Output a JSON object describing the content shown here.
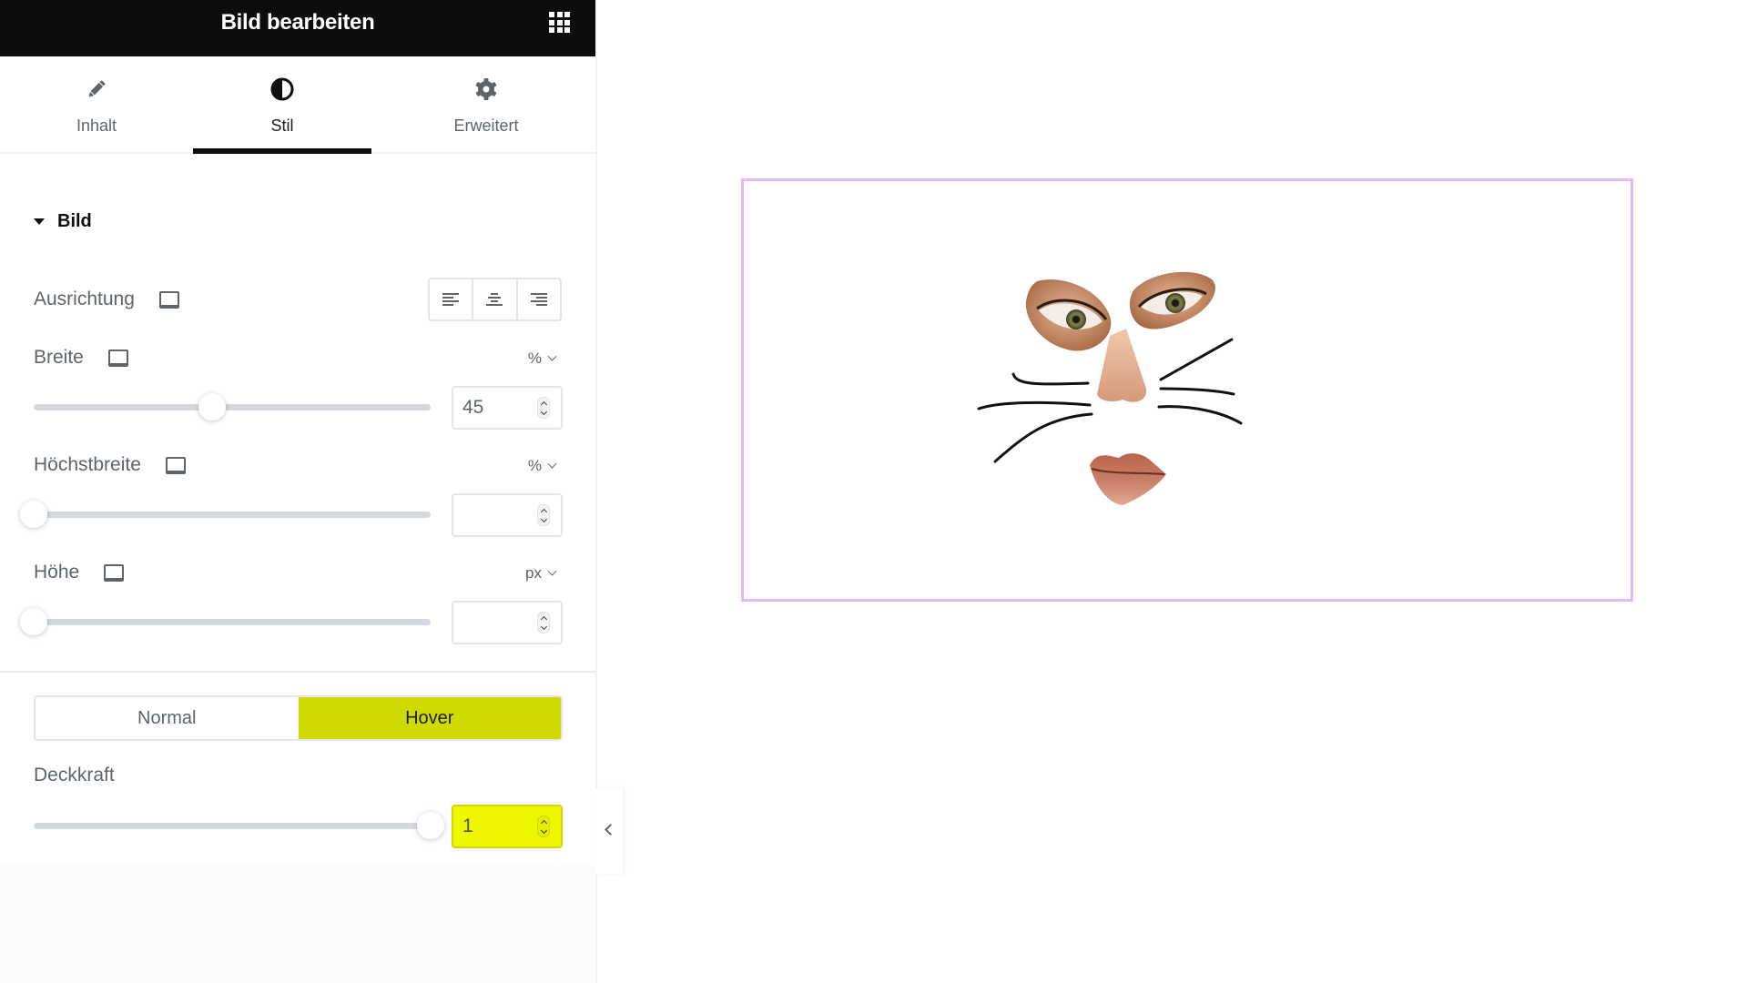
{
  "header": {
    "title": "Bild bearbeiten",
    "apps_icon": "grid-icon"
  },
  "tabs": [
    {
      "label": "Inhalt",
      "icon": "pencil-icon",
      "active": false
    },
    {
      "label": "Stil",
      "icon": "contrast-icon",
      "active": true
    },
    {
      "label": "Erweitert",
      "icon": "gear-icon",
      "active": false
    }
  ],
  "section": {
    "title": "Bild",
    "expanded": true
  },
  "controls": {
    "alignment": {
      "label": "Ausrichtung",
      "options": [
        "left",
        "center",
        "right"
      ]
    },
    "width": {
      "label": "Breite",
      "unit": "%",
      "value": "45",
      "slider_percent": 45
    },
    "max_width": {
      "label": "Höchstbreite",
      "unit": "%",
      "value": "",
      "slider_percent": 0
    },
    "height": {
      "label": "Höhe",
      "unit": "px",
      "value": "",
      "slider_percent": 0
    }
  },
  "state_toggle": {
    "normal_label": "Normal",
    "hover_label": "Hover",
    "active": "Hover"
  },
  "opacity": {
    "label": "Deckkraft",
    "value": "1",
    "slider_percent": 100
  },
  "colors": {
    "accent": "#cfdb00",
    "highlight_input": "#eef600",
    "frame_border": "#e6b8f5",
    "header_bg": "#0c0d0e"
  },
  "preview": {
    "image_alt": "Cat-face collage of eyes, nose and lips with whiskers"
  }
}
